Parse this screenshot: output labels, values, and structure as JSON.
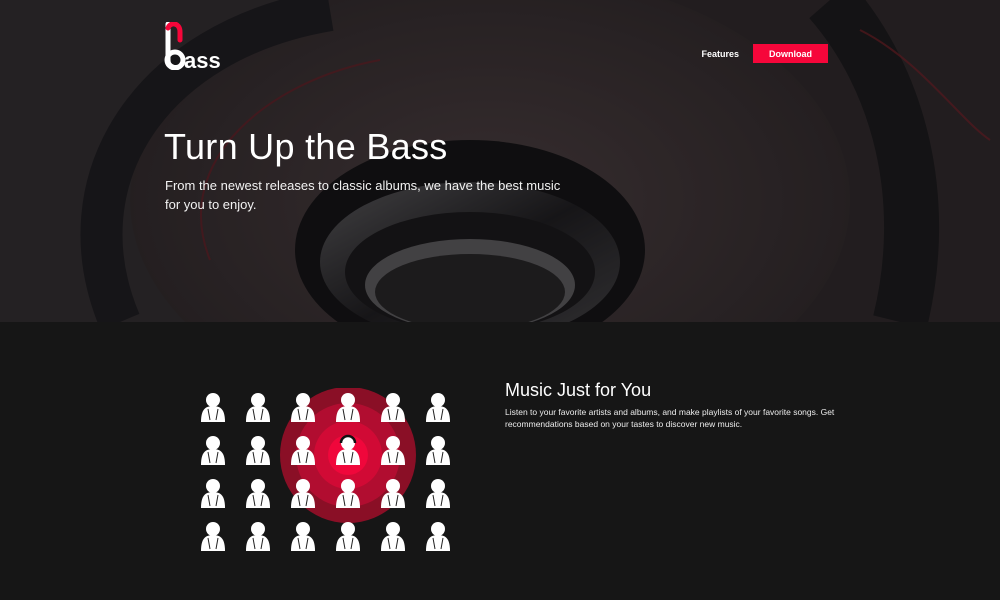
{
  "brand": {
    "logo_text": "bass",
    "accent": "#f6063a"
  },
  "nav": {
    "features_label": "Features",
    "download_label": "Download"
  },
  "hero": {
    "title": "Turn Up the Bass",
    "subtitle": "From the newest releases to classic albums, we have the best music for you to enjoy."
  },
  "feature": {
    "title": "Music Just for You",
    "text": "Listen to your favorite artists and albums, and make playlists of your favorite songs. Get recommendations based on your tastes to discover new music.",
    "icon": "people-target-icon",
    "grid": {
      "rows": 4,
      "cols": 6,
      "highlight_row": 1,
      "highlight_col": 3
    }
  },
  "colors": {
    "page_bg": "#161616",
    "button": "#f6063a",
    "text": "#ffffff"
  }
}
